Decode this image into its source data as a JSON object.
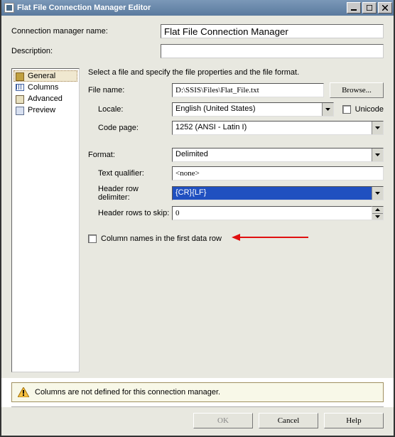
{
  "window": {
    "title": "Flat File Connection Manager Editor"
  },
  "top": {
    "name_label": "Connection manager name:",
    "name_value": "Flat File Connection Manager",
    "desc_label": "Description:",
    "desc_value": ""
  },
  "sidebar": {
    "items": [
      "General",
      "Columns",
      "Advanced",
      "Preview"
    ]
  },
  "content": {
    "instruction": "Select a file and specify the file properties and the file format.",
    "file_label": "File name:",
    "file_value": "D:\\SSIS\\Files\\Flat_File.txt",
    "browse": "Browse...",
    "locale_label": "Locale:",
    "locale_value": "English (United States)",
    "unicode_label": "Unicode",
    "codepage_label": "Code page:",
    "codepage_value": "1252  (ANSI - Latin I)",
    "format_label": "Format:",
    "format_value": "Delimited",
    "textq_label": "Text qualifier:",
    "textq_value": "<none>",
    "hdrdelim_label": "Header row delimiter:",
    "hdrdelim_value": "{CR}{LF}",
    "hdrskip_label": "Header rows to skip:",
    "hdrskip_value": "0",
    "colnames_label": "Column names in the first data row"
  },
  "info": {
    "warning": "Columns are not defined for this connection manager."
  },
  "buttons": {
    "ok": "OK",
    "cancel": "Cancel",
    "help": "Help"
  }
}
